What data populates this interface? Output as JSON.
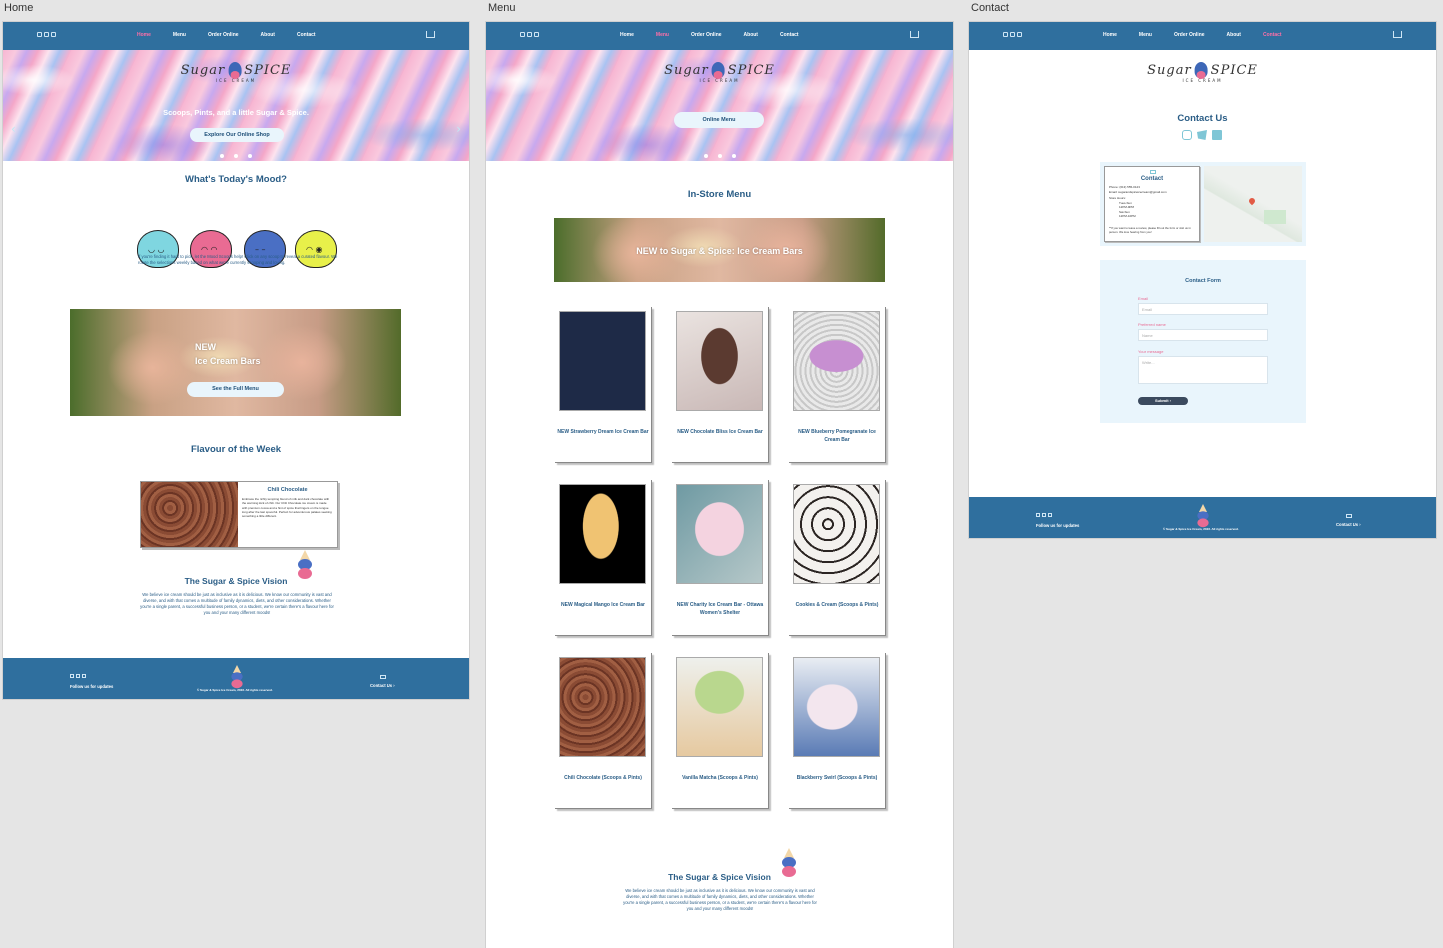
{
  "artboards": {
    "home": "Home",
    "menu": "Menu",
    "contact": "Contact"
  },
  "nav": {
    "links": [
      "Home",
      "Menu",
      "Order Online",
      "About",
      "Contact"
    ]
  },
  "icons": {
    "social": [
      "instagram-icon",
      "twitter-icon",
      "facebook-icon"
    ],
    "cart": "cart-icon",
    "mail": "mail-icon"
  },
  "colors": {
    "nav_bg": "#2f6f9e",
    "active_link": "#ff6fa8",
    "heading": "#2a5d86",
    "pill_bg": "#e9f5fc"
  },
  "logo": {
    "word1": "Sugar",
    "word2": "SPICE",
    "sub": "ICE CREAM"
  },
  "home": {
    "hero_text": "Scoops, Pints, and a little Sugar & Spice.",
    "hero_button": "Explore Our Online Shop",
    "mood_title": "What's Today's Mood?",
    "mood_text": "If you're finding it hard to pick, let the Mood Scoops help! Click on any scoop to reveal a curated flavour. We rotate the selections weekly based on what we're currently scooping and loving.",
    "promo_line1": "NEW",
    "promo_line2": "Ice Cream Bars",
    "promo_button": "See the Full Menu",
    "flavour_title": "Flavour of the Week",
    "flavour_name": "Chili Chocolate",
    "flavour_text": "Embrace the richly tempting blend of milk and dark chocolate with the warming kick of chili. Our Chili Chocolate ice cream is made with premium cocoa and a hint of spice that lingers on the tongue long after the last spoonful. Perfect for adventurous palates seeking something a little different."
  },
  "vision": {
    "title": "The Sugar & Spice Vision",
    "text": "We believe ice cream should be just as inclusive as it is delicious. We know our community is vast and diverse, and with that comes a multitude of family dynamics, diets, and other considerations. Whether you're a single parent, a successful business person, or a student, we're certain there's a flavour here for you and your many different moods!"
  },
  "footer": {
    "follow": "Follow us for updates",
    "copyright": "© Sugar & Spice Ice Cream, 2023. All rights reserved.",
    "contact": "Contact Us"
  },
  "menu": {
    "hero_button": "Online Menu",
    "title": "In-Store Menu",
    "banner": "NEW to Sugar & Spice: Ice Cream Bars",
    "items": [
      "NEW Strawberry Dream Ice Cream Bar",
      "NEW Chocolate Bliss Ice Cream Bar",
      "NEW Blueberry Pomegranate Ice Cream Bar",
      "NEW Magical Mango Ice Cream Bar",
      "NEW Charity Ice Cream Bar - Ottawa Women's Shelter",
      "Cookies & Cream (Scoops & Pints)",
      "Chili Chocolate (Scoops & Pints)",
      "Vanilla Matcha (Scoops & Pints)",
      "Blackberry Swirl (Scoops & Pints)"
    ]
  },
  "contact": {
    "title": "Contact Us",
    "card_title": "Contact",
    "card_lines": [
      "Phone: (613) 555-0123",
      "Email: sugarandspiceicecream@gmail.com",
      "Store Hours:",
      "Tues-Sun",
      "12PM-9PM",
      "Sat-Sun",
      "12PM-10PM"
    ],
    "card_note": "**If you want to leave a review, please fill out the form or visit us in person. We love hearing from you!",
    "form_title": "Contact Form",
    "email_label": "Email",
    "email_placeholder": "Email",
    "name_label": "Preferred name",
    "name_placeholder": "Name",
    "message_label": "Your message",
    "message_placeholder": "Write...",
    "submit": "Submit"
  }
}
